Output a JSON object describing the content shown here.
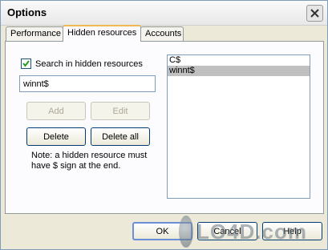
{
  "window": {
    "title": "Options"
  },
  "tabs": [
    {
      "label": "Performance"
    },
    {
      "label": "Hidden resources"
    },
    {
      "label": "Accounts"
    }
  ],
  "panel": {
    "checkbox_label": "Search in hidden resources",
    "checkbox_checked": true,
    "input_value": "winnt$",
    "buttons": {
      "add": "Add",
      "edit": "Edit",
      "delete": "Delete",
      "delete_all": "Delete all"
    },
    "note": "Note: a hidden resource must have $ sign at the end.",
    "list_items": [
      {
        "label": "C$",
        "selected": false
      },
      {
        "label": "winnt$",
        "selected": true
      }
    ]
  },
  "footer": {
    "ok": "OK",
    "cancel": "Cancel",
    "help": "Help"
  },
  "watermark": {
    "text": "LO4D.com"
  }
}
